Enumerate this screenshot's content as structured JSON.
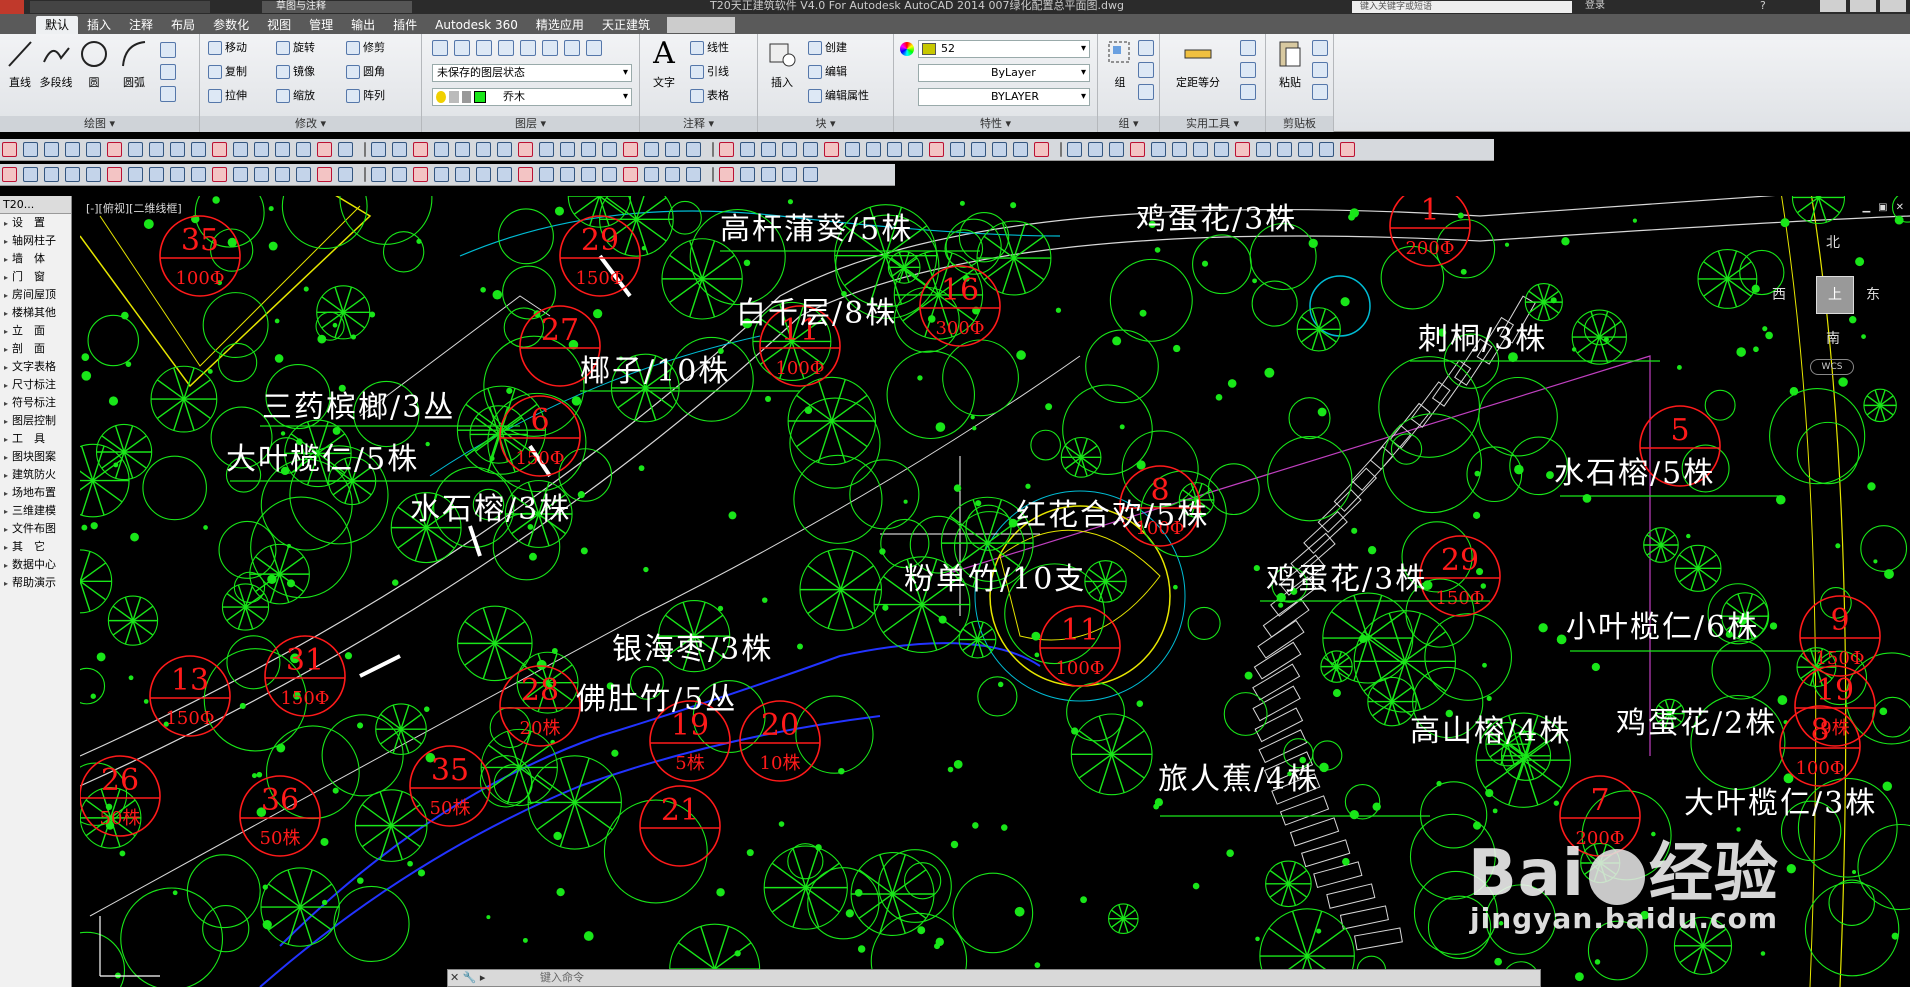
{
  "titlebar": {
    "title": "T20天正建筑软件 V4.0 For Autodesk AutoCAD 2014    007绿化配置总平面图.dwg",
    "workspace": "草图与注释",
    "search_placeholder": "键入关键字或短语",
    "login": "登录"
  },
  "ribbon_tabs": [
    "默认",
    "插入",
    "注释",
    "布局",
    "参数化",
    "视图",
    "管理",
    "输出",
    "插件",
    "Autodesk 360",
    "精选应用",
    "天正建筑"
  ],
  "ribbon": {
    "draw": {
      "title": "绘图 ▾",
      "line": "直线",
      "polyline": "多段线",
      "circle": "圆",
      "arc": "圆弧"
    },
    "modify": {
      "title": "修改 ▾",
      "items": [
        "移动",
        "旋转",
        "修剪",
        "复制",
        "镜像",
        "圆角",
        "拉伸",
        "缩放",
        "阵列"
      ]
    },
    "layers": {
      "title": "图层 ▾",
      "state": "未保存的图层状态",
      "current": "乔木"
    },
    "annotation": {
      "title": "注释 ▾",
      "text": "文字",
      "items": [
        "线性",
        "引线",
        "表格"
      ]
    },
    "block": {
      "title": "块 ▾",
      "insert": "插入",
      "items": [
        "创建",
        "编辑",
        "编辑属性"
      ]
    },
    "properties": {
      "title": "特性 ▾",
      "color": "52",
      "linetype": "ByLayer",
      "lineweight": "BYLAYER"
    },
    "groups": {
      "title": "组 ▾",
      "group": "组"
    },
    "utilities": {
      "title": "实用工具 ▾",
      "measure": "定距等分"
    },
    "clipboard": {
      "title": "剪贴板",
      "paste": "粘贴"
    }
  },
  "palette": {
    "header": "T20...",
    "items": [
      "设　置",
      "轴网柱子",
      "墙　体",
      "门　窗",
      "房间屋顶",
      "楼梯其他",
      "立　面",
      "剖　面",
      "文字表格",
      "尺寸标注",
      "符号标注",
      "图层控制",
      "工　具",
      "图块图案",
      "建筑防火",
      "场地布置",
      "三维建模",
      "文件布图",
      "其　它",
      "数据中心",
      "帮助演示"
    ]
  },
  "viewport": {
    "label": "[-][俯视][二维线框]",
    "compass": {
      "north": "北",
      "south": "南",
      "east": "东",
      "west": "西",
      "top": "上",
      "wcs": "WCS"
    }
  },
  "plant_labels": [
    "高杆蒲葵/5株",
    "鸡蛋花/3株",
    "白千层/8株",
    "椰子/10株",
    "刺桐/3株",
    "三药槟榔/3丛",
    "大叶榄仁/5株",
    "水石榕/3株",
    "水石榕/5株",
    "小叶榄仁/6株",
    "鸡蛋花/3株",
    "红花合欢/5株",
    "粉单竹/10支",
    "银海枣/3株",
    "佛肚竹/5丛",
    "高山榕/4株",
    "鸡蛋花/2株",
    "旅人蕉/4株",
    "大叶榄仁/3株"
  ],
  "tags": [
    {
      "num": "35",
      "sub": "100Φ"
    },
    {
      "num": "29",
      "sub": "150Φ"
    },
    {
      "num": "27",
      "sub": ""
    },
    {
      "num": "16",
      "sub": "300Φ"
    },
    {
      "num": "11",
      "sub": "100Φ"
    },
    {
      "num": "6",
      "sub": "150Φ"
    },
    {
      "num": "1",
      "sub": "200Φ"
    },
    {
      "num": "5",
      "sub": ""
    },
    {
      "num": "8",
      "sub": "100Φ"
    },
    {
      "num": "29",
      "sub": "150Φ"
    },
    {
      "num": "11",
      "sub": "100Φ"
    },
    {
      "num": "31",
      "sub": "150Φ"
    },
    {
      "num": "13",
      "sub": "150Φ"
    },
    {
      "num": "8",
      "sub": "100Φ"
    },
    {
      "num": "28",
      "sub": "20株"
    },
    {
      "num": "19",
      "sub": "5株"
    },
    {
      "num": "20",
      "sub": "10株"
    },
    {
      "num": "35",
      "sub": "50株"
    },
    {
      "num": "36",
      "sub": "50株"
    },
    {
      "num": "26",
      "sub": "50株"
    },
    {
      "num": "21",
      "sub": ""
    },
    {
      "num": "19",
      "sub": "9株"
    },
    {
      "num": "9",
      "sub": "150Φ"
    },
    {
      "num": "7",
      "sub": "200Φ"
    }
  ],
  "command_prompt": "键入命令",
  "watermark": {
    "brand_a": "Bai",
    "brand_b": "经验",
    "url": "jingyan.baidu.com"
  },
  "colors": {
    "plant_green": "#19e619",
    "tag_red": "#ff1a1a",
    "road_white": "#d8d8d8",
    "wall_yellow": "#e6e600",
    "cyan": "#00bcd4",
    "blue": "#2233ff",
    "magenta": "#c040c0",
    "background": "#000000"
  }
}
